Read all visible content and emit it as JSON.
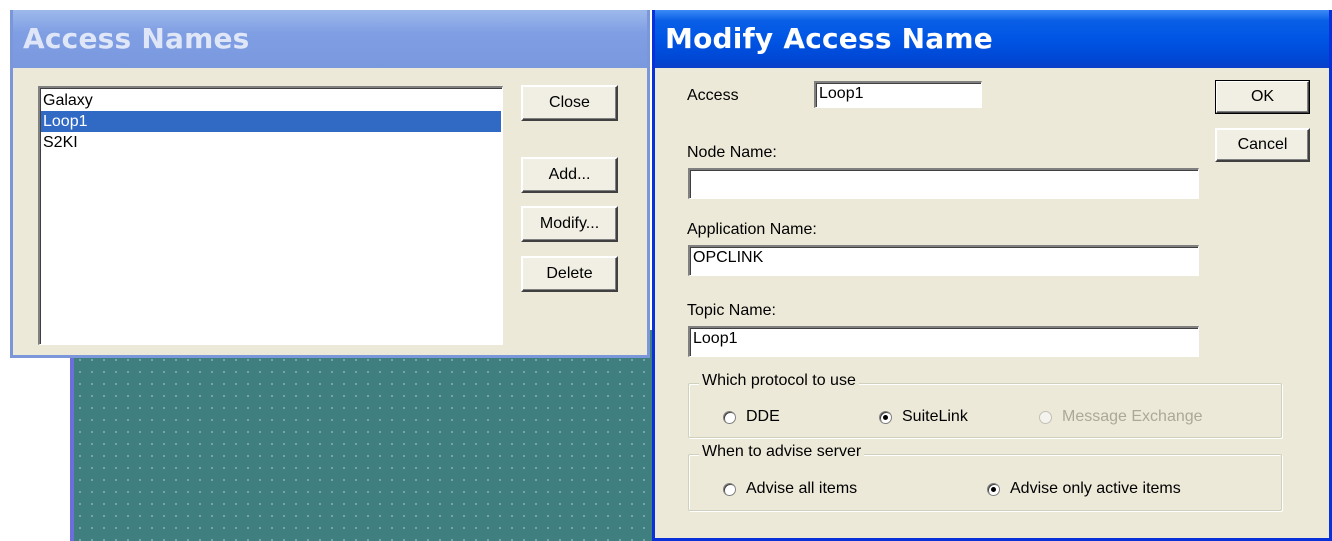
{
  "access_names": {
    "title": "Access Names",
    "items": [
      "Galaxy",
      "Loop1",
      "S2KI"
    ],
    "selected_index": 1,
    "buttons": {
      "close": "Close",
      "add": "Add...",
      "modify": "Modify...",
      "delete": "Delete"
    }
  },
  "modify_dialog": {
    "title": "Modify Access Name",
    "access_label": "Access",
    "access_value": "Loop1",
    "node_label": "Node Name:",
    "node_value": "",
    "app_label": "Application Name:",
    "app_value": "OPCLINK",
    "topic_label": "Topic Name:",
    "topic_value": "Loop1",
    "ok": "OK",
    "cancel": "Cancel",
    "protocol_group": {
      "title": "Which protocol to use",
      "options": [
        {
          "label": "DDE",
          "selected": false,
          "enabled": true
        },
        {
          "label": "SuiteLink",
          "selected": true,
          "enabled": true
        },
        {
          "label": "Message Exchange",
          "selected": false,
          "enabled": false
        }
      ]
    },
    "advise_group": {
      "title": "When to advise server",
      "options": [
        {
          "label": "Advise all items",
          "selected": false,
          "enabled": true
        },
        {
          "label": "Advise only active items",
          "selected": true,
          "enabled": true
        }
      ]
    }
  },
  "colors": {
    "dialog_bg": "#ece9d8",
    "active_title": "#0055e5",
    "inactive_title": "#7f9ee3",
    "selection": "#316ac5",
    "canvas": "#3f7f7f"
  }
}
